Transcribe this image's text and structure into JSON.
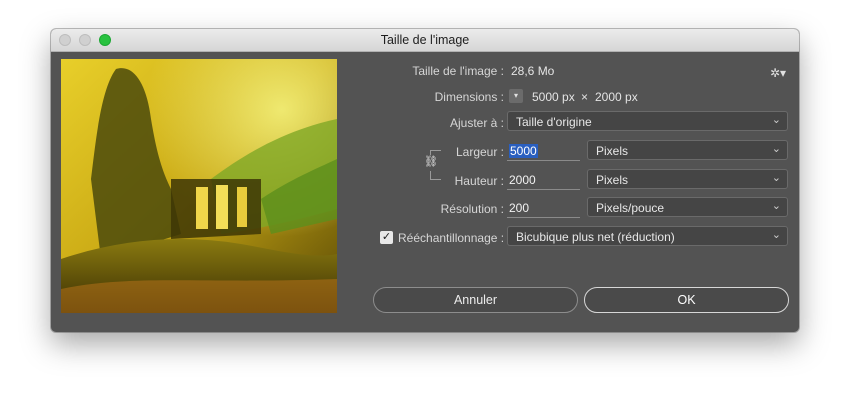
{
  "window": {
    "title": "Taille de l'image"
  },
  "image_size": {
    "label": "Taille de l'image :",
    "value": "28,6 Mo"
  },
  "dimensions": {
    "label": "Dimensions :",
    "width": "5000 px",
    "separator": "×",
    "height": "2000 px"
  },
  "fit_to": {
    "label": "Ajuster à :",
    "value": "Taille d'origine"
  },
  "width": {
    "label": "Largeur :",
    "value": "5000",
    "unit": "Pixels"
  },
  "height": {
    "label": "Hauteur :",
    "value": "2000",
    "unit": "Pixels"
  },
  "resolution": {
    "label": "Résolution :",
    "value": "200",
    "unit": "Pixels/pouce"
  },
  "resample": {
    "label": "Rééchantillonnage :",
    "checked": true,
    "value": "Bicubique plus net (réduction)"
  },
  "buttons": {
    "cancel": "Annuler",
    "ok": "OK"
  },
  "icons": {
    "gear": "gear-icon",
    "chain": "chain-link-icon",
    "chevron": "chevron-down-icon",
    "checkmark": "checkmark-icon"
  },
  "colors": {
    "dialog_bg": "#535353",
    "selection": "#2a5fbf",
    "zoom_button": "#29c240"
  }
}
